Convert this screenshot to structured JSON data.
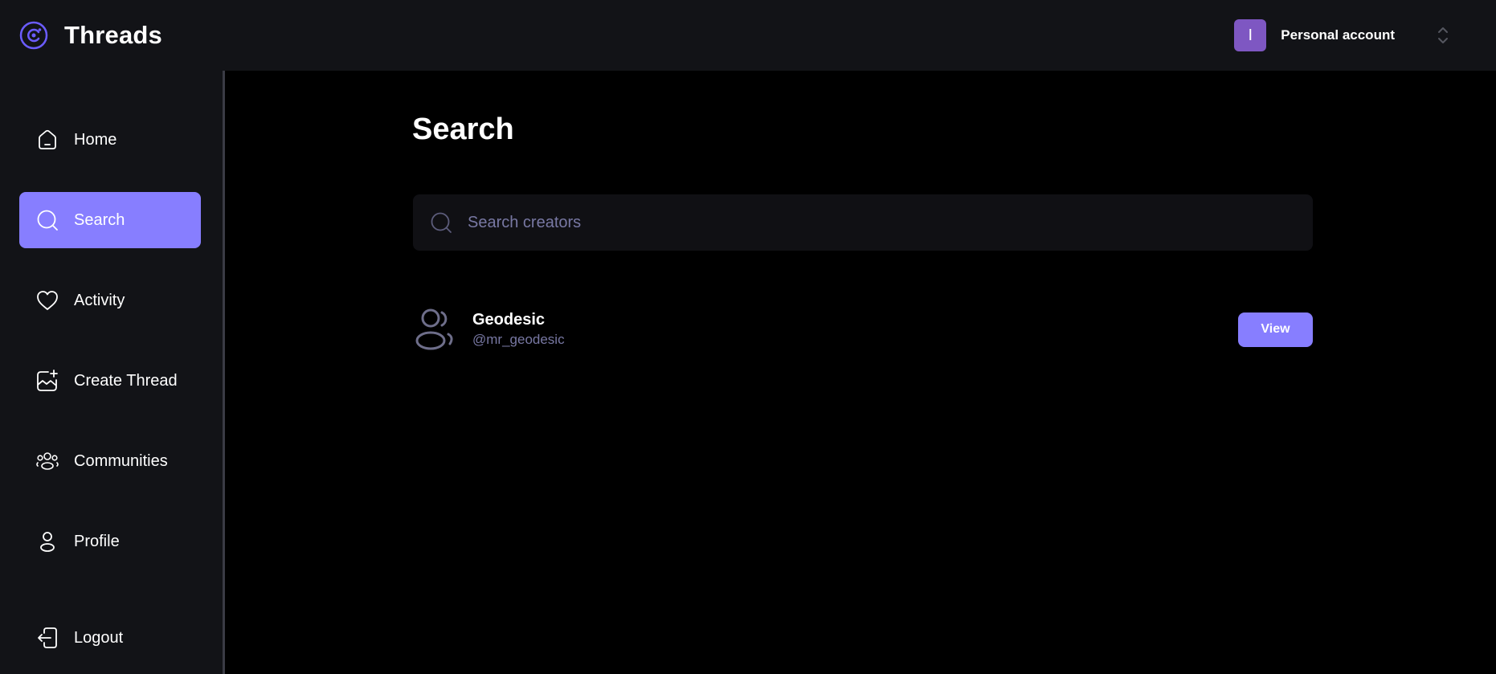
{
  "colors": {
    "accent": "#877eff",
    "topbar_bg": "#121317",
    "main_bg": "#000000",
    "muted_text": "#7878a3",
    "avatar_bg": "#7e57c2"
  },
  "header": {
    "brand_name": "Threads",
    "brand_icon": "threads-logo-icon",
    "account": {
      "avatar_initial": "I",
      "label": "Personal account",
      "switch_icon": "chevron-up-down-icon"
    }
  },
  "sidebar": {
    "items": [
      {
        "label": "Home",
        "icon": "home-icon",
        "active": false
      },
      {
        "label": "Search",
        "icon": "search-icon",
        "active": true
      },
      {
        "label": "Activity",
        "icon": "heart-icon",
        "active": false
      },
      {
        "label": "Create Thread",
        "icon": "create-thread-icon",
        "active": false
      },
      {
        "label": "Communities",
        "icon": "communities-icon",
        "active": false
      },
      {
        "label": "Profile",
        "icon": "user-icon",
        "active": false
      }
    ],
    "logout": {
      "label": "Logout",
      "icon": "logout-icon"
    }
  },
  "main": {
    "title": "Search",
    "search": {
      "placeholder": "Search creators",
      "value": ""
    },
    "results": [
      {
        "name": "Geodesic",
        "handle": "@mr_geodesic",
        "avatar_icon": "user-group-icon",
        "action_label": "View"
      }
    ]
  }
}
